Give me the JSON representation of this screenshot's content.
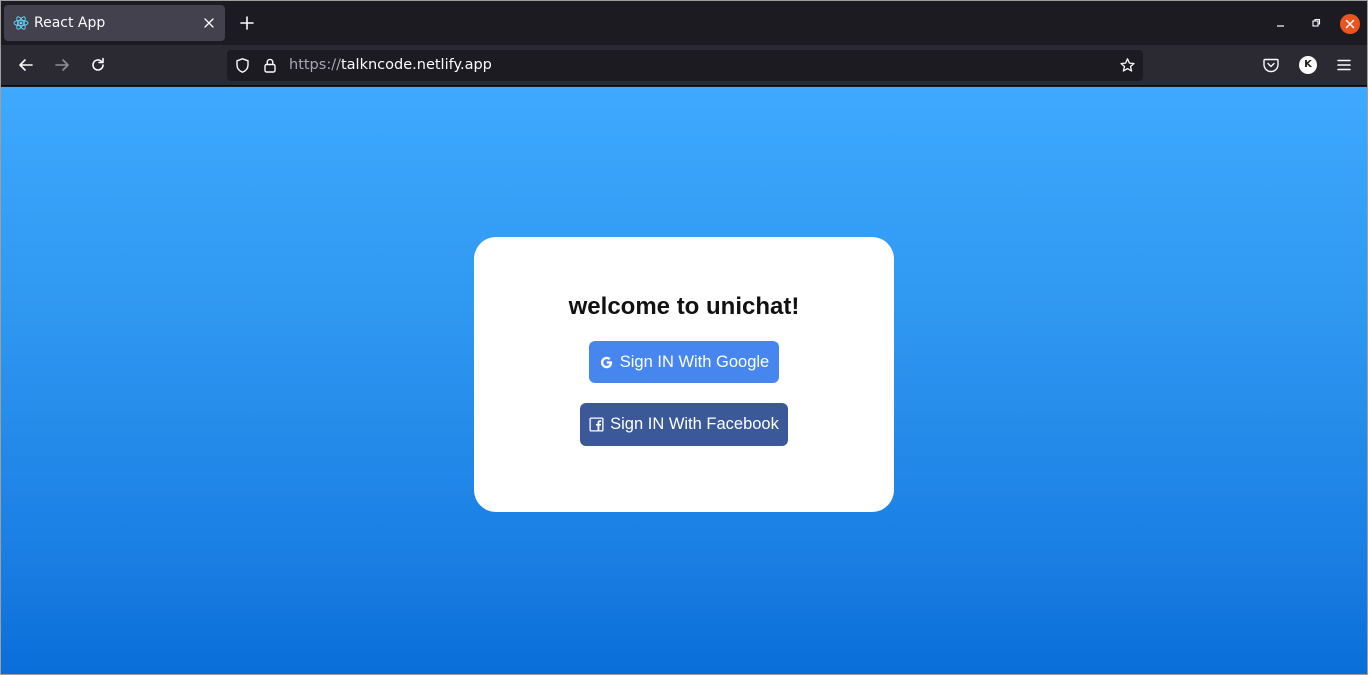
{
  "browser": {
    "tab_title": "React App",
    "url_scheme": "https://",
    "url_host": "talkncode.netlify.app",
    "account_initial": "K"
  },
  "icons": {
    "tab_favicon": "react-logo-icon",
    "tab_close": "close-icon",
    "new_tab": "plus-icon",
    "back": "arrow-left-icon",
    "forward": "arrow-right-icon",
    "reload": "reload-icon",
    "tracking_protection": "shield-icon",
    "connection": "lock-icon",
    "bookmark": "star-icon",
    "pocket": "pocket-icon",
    "menu": "hamburger-menu-icon",
    "google": "google-g-icon",
    "facebook": "facebook-f-icon"
  },
  "login": {
    "title": "welcome to unichat!",
    "google_label": "Sign IN With Google",
    "facebook_label": "Sign IN With Facebook"
  },
  "colors": {
    "google_button": "#4786ee",
    "facebook_button": "#3b5998",
    "window_close": "#e95420",
    "background_top": "#3ea9ff",
    "background_bottom": "#0a6ed9"
  }
}
